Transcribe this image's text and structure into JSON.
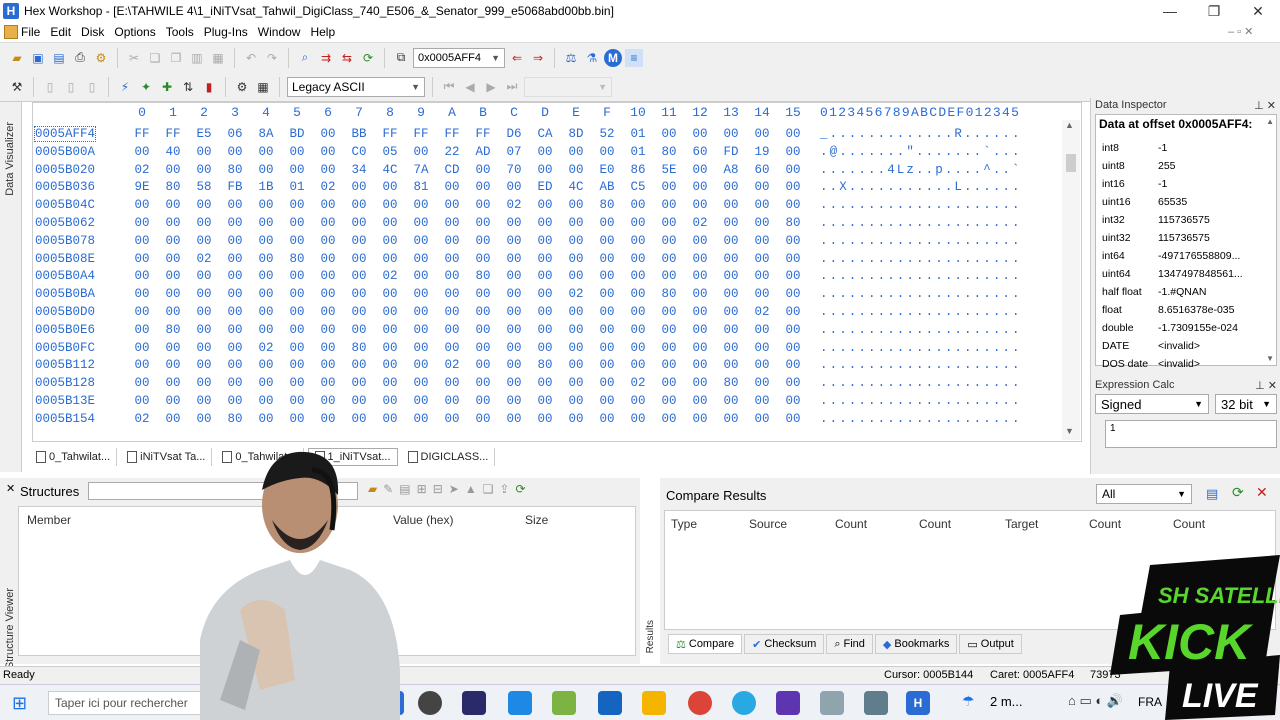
{
  "window": {
    "app_icon": "H",
    "title": "Hex Workshop - [E:\\TAHWILE 4\\1_iNiTVsat_Tahwil_DigiClass_740_E506_&_Senator_999_e5068abd00bb.bin]",
    "controls": [
      "minimize-icon",
      "restore-icon",
      "close-icon"
    ]
  },
  "menu": [
    "File",
    "Edit",
    "Disk",
    "Options",
    "Tools",
    "Plug-Ins",
    "Window",
    "Help"
  ],
  "toolbar": {
    "address_value": "0x0005AFF4",
    "encoding_value": "Legacy ASCII"
  },
  "left_tabs": {
    "data_visualizer": "Data Visualizer",
    "structure_viewer": "Structure Viewer"
  },
  "hex": {
    "column_headers": [
      "0",
      "1",
      "2",
      "3",
      "4",
      "5",
      "6",
      "7",
      "8",
      "9",
      "A",
      "B",
      "C",
      "D",
      "E",
      "F",
      "10",
      "11",
      "12",
      "13",
      "14",
      "15"
    ],
    "ascii_header": "0123456789ABCDEF012345",
    "rows": [
      {
        "offset": "0005AFF4",
        "bytes": [
          "FF",
          "FF",
          "E5",
          "06",
          "8A",
          "BD",
          "00",
          "BB",
          "FF",
          "FF",
          "FF",
          "FF",
          "D6",
          "CA",
          "8D",
          "52",
          "01",
          "00",
          "00",
          "00",
          "00",
          "00"
        ],
        "ascii": "_.............R......"
      },
      {
        "offset": "0005B00A",
        "bytes": [
          "00",
          "40",
          "00",
          "00",
          "00",
          "00",
          "00",
          "C0",
          "05",
          "00",
          "22",
          "AD",
          "07",
          "00",
          "00",
          "00",
          "01",
          "80",
          "60",
          "FD",
          "19",
          "00"
        ],
        "ascii": ".@.......\".......`..."
      },
      {
        "offset": "0005B020",
        "bytes": [
          "02",
          "00",
          "00",
          "80",
          "00",
          "00",
          "00",
          "34",
          "4C",
          "7A",
          "CD",
          "00",
          "70",
          "00",
          "00",
          "E0",
          "86",
          "5E",
          "00",
          "A8",
          "60",
          "00"
        ],
        "ascii": ".......4Lz..p....^..`"
      },
      {
        "offset": "0005B036",
        "bytes": [
          "9E",
          "80",
          "58",
          "FB",
          "1B",
          "01",
          "02",
          "00",
          "00",
          "81",
          "00",
          "00",
          "00",
          "ED",
          "4C",
          "AB",
          "C5",
          "00",
          "00",
          "00",
          "00",
          "00"
        ],
        "ascii": "..X...........L......"
      },
      {
        "offset": "0005B04C",
        "bytes": [
          "00",
          "00",
          "00",
          "00",
          "00",
          "00",
          "00",
          "00",
          "00",
          "00",
          "00",
          "00",
          "02",
          "00",
          "00",
          "80",
          "00",
          "00",
          "00",
          "00",
          "00",
          "00"
        ],
        "ascii": "....................."
      },
      {
        "offset": "0005B062",
        "bytes": [
          "00",
          "00",
          "00",
          "00",
          "00",
          "00",
          "00",
          "00",
          "00",
          "00",
          "00",
          "00",
          "00",
          "00",
          "00",
          "00",
          "00",
          "00",
          "02",
          "00",
          "00",
          "80"
        ],
        "ascii": "....................."
      },
      {
        "offset": "0005B078",
        "bytes": [
          "00",
          "00",
          "00",
          "00",
          "00",
          "00",
          "00",
          "00",
          "00",
          "00",
          "00",
          "00",
          "00",
          "00",
          "00",
          "00",
          "00",
          "00",
          "00",
          "00",
          "00",
          "00"
        ],
        "ascii": "....................."
      },
      {
        "offset": "0005B08E",
        "bytes": [
          "00",
          "00",
          "02",
          "00",
          "00",
          "80",
          "00",
          "00",
          "00",
          "00",
          "00",
          "00",
          "00",
          "00",
          "00",
          "00",
          "00",
          "00",
          "00",
          "00",
          "00",
          "00"
        ],
        "ascii": "....................."
      },
      {
        "offset": "0005B0A4",
        "bytes": [
          "00",
          "00",
          "00",
          "00",
          "00",
          "00",
          "00",
          "00",
          "02",
          "00",
          "00",
          "80",
          "00",
          "00",
          "00",
          "00",
          "00",
          "00",
          "00",
          "00",
          "00",
          "00"
        ],
        "ascii": "....................."
      },
      {
        "offset": "0005B0BA",
        "bytes": [
          "00",
          "00",
          "00",
          "00",
          "00",
          "00",
          "00",
          "00",
          "00",
          "00",
          "00",
          "00",
          "00",
          "00",
          "02",
          "00",
          "00",
          "80",
          "00",
          "00",
          "00",
          "00"
        ],
        "ascii": "....................."
      },
      {
        "offset": "0005B0D0",
        "bytes": [
          "00",
          "00",
          "00",
          "00",
          "00",
          "00",
          "00",
          "00",
          "00",
          "00",
          "00",
          "00",
          "00",
          "00",
          "00",
          "00",
          "00",
          "00",
          "00",
          "00",
          "02",
          "00"
        ],
        "ascii": "....................."
      },
      {
        "offset": "0005B0E6",
        "bytes": [
          "00",
          "80",
          "00",
          "00",
          "00",
          "00",
          "00",
          "00",
          "00",
          "00",
          "00",
          "00",
          "00",
          "00",
          "00",
          "00",
          "00",
          "00",
          "00",
          "00",
          "00",
          "00"
        ],
        "ascii": "....................."
      },
      {
        "offset": "0005B0FC",
        "bytes": [
          "00",
          "00",
          "00",
          "00",
          "02",
          "00",
          "00",
          "80",
          "00",
          "00",
          "00",
          "00",
          "00",
          "00",
          "00",
          "00",
          "00",
          "00",
          "00",
          "00",
          "00",
          "00"
        ],
        "ascii": "....................."
      },
      {
        "offset": "0005B112",
        "bytes": [
          "00",
          "00",
          "00",
          "00",
          "00",
          "00",
          "00",
          "00",
          "00",
          "00",
          "02",
          "00",
          "00",
          "80",
          "00",
          "00",
          "00",
          "00",
          "00",
          "00",
          "00",
          "00"
        ],
        "ascii": "....................."
      },
      {
        "offset": "0005B128",
        "bytes": [
          "00",
          "00",
          "00",
          "00",
          "00",
          "00",
          "00",
          "00",
          "00",
          "00",
          "00",
          "00",
          "00",
          "00",
          "00",
          "00",
          "02",
          "00",
          "00",
          "80",
          "00",
          "00"
        ],
        "ascii": "....................."
      },
      {
        "offset": "0005B13E",
        "bytes": [
          "00",
          "00",
          "00",
          "00",
          "00",
          "00",
          "00",
          "00",
          "00",
          "00",
          "00",
          "00",
          "00",
          "00",
          "00",
          "00",
          "00",
          "00",
          "00",
          "00",
          "00",
          "00"
        ],
        "ascii": "....................."
      },
      {
        "offset": "0005B154",
        "bytes": [
          "02",
          "00",
          "00",
          "80",
          "00",
          "00",
          "00",
          "00",
          "00",
          "00",
          "00",
          "00",
          "00",
          "00",
          "00",
          "00",
          "00",
          "00",
          "00",
          "00",
          "00",
          "00"
        ],
        "ascii": "....................."
      }
    ]
  },
  "file_tabs": [
    "0_Tahwilat...",
    "iNiTVsat Ta...",
    "0_Tahwilat...",
    "1_iNiTVsat...",
    "DIGICLASS..."
  ],
  "inspector": {
    "panel_title": "Data Inspector",
    "heading": "Data at offset 0x0005AFF4:",
    "rows": [
      {
        "k": "int8",
        "v": "-1"
      },
      {
        "k": "uint8",
        "v": "255"
      },
      {
        "k": "int16",
        "v": "-1"
      },
      {
        "k": "uint16",
        "v": "65535"
      },
      {
        "k": "int32",
        "v": "115736575"
      },
      {
        "k": "uint32",
        "v": "115736575"
      },
      {
        "k": "int64",
        "v": "-497176558809..."
      },
      {
        "k": "uint64",
        "v": "1347497848561..."
      },
      {
        "k": "half float",
        "v": "-1.#QNAN"
      },
      {
        "k": "float",
        "v": "8.6516378e-035"
      },
      {
        "k": "double",
        "v": "-1.7309155e-024"
      },
      {
        "k": "DATE",
        "v": "<invalid>"
      },
      {
        "k": "DOS date",
        "v": "<invalid>"
      }
    ]
  },
  "calc": {
    "panel_title": "Expression Calc",
    "signed": "Signed",
    "bits": "32 bit",
    "input": "1"
  },
  "structures": {
    "title": "Structures",
    "cols": [
      "Member",
      "Value (hex)",
      "Size"
    ]
  },
  "compare": {
    "title": "Compare Results",
    "filter": "All",
    "cols": [
      "Type",
      "Source",
      "Count",
      "Count",
      "Target",
      "Count",
      "Count"
    ],
    "tabs": [
      "Compare",
      "Checksum",
      "Find",
      "Bookmarks",
      "Output"
    ],
    "side_label": "Results"
  },
  "status": {
    "ready": "Ready",
    "cursor": "Cursor: 0005B144",
    "caret": "Caret: 0005AFF4",
    "size": "73973"
  },
  "taskbar": {
    "search_placeholder": "Taper ici pour rechercher",
    "lang": "FRA",
    "notif": "2 m..."
  },
  "overlay": {
    "brand_top": "SH SATELLITE",
    "brand_main": "KICK",
    "brand_sub": "LIVE"
  },
  "colors": {
    "hex_text": "#2b6cd4",
    "accent_green": "#59d62b",
    "logo_dark": "#0a0a0a"
  }
}
